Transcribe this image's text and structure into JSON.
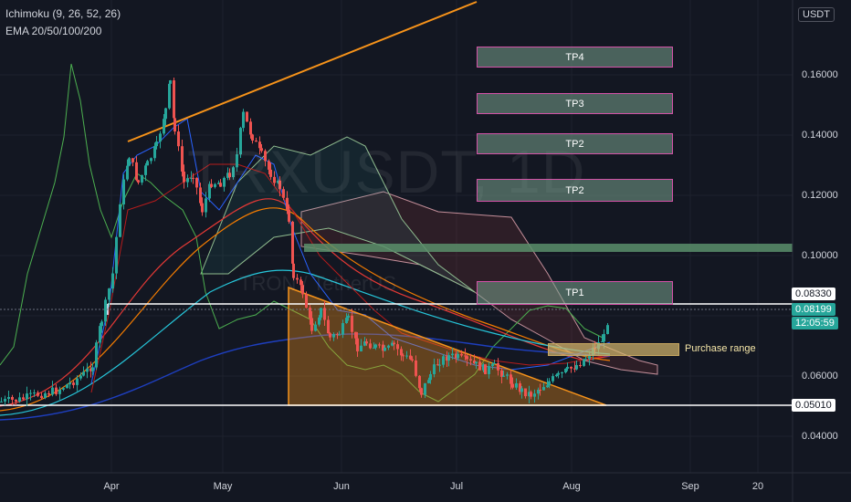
{
  "indicators": {
    "ichimoku": "Ichimoku (9, 26, 52, 26)",
    "ema": "EMA 20/50/100/200"
  },
  "watermark": {
    "symbol": "TRXUSDT, 1D",
    "pair": "TRON / TetherUS"
  },
  "price_axis": {
    "currency": "USDT",
    "ticks": [
      "0.16000",
      "0.14000",
      "0.12000",
      "0.10000",
      "0.08000",
      "0.06000",
      "0.04000"
    ],
    "level_tags": [
      {
        "value": "0.08330",
        "color": "#ffffff",
        "text": "#131722"
      },
      {
        "value": "0.08199",
        "color": "#26a69a",
        "text": "#ffffff"
      },
      {
        "value": "12:05:59",
        "color": "#26a69a",
        "text": "#ffffff"
      },
      {
        "value": "0.05010",
        "color": "#ffffff",
        "text": "#131722"
      }
    ]
  },
  "time_axis": {
    "ticks": [
      "Apr",
      "May",
      "Jun",
      "Jul",
      "Aug",
      "Sep",
      "20"
    ]
  },
  "targets": [
    {
      "label": "TP4"
    },
    {
      "label": "TP3"
    },
    {
      "label": "TP2"
    },
    {
      "label": "TP2"
    },
    {
      "label": "TP1"
    }
  ],
  "purchase_zone": {
    "label": "Purchase range"
  },
  "colors": {
    "background": "#131722",
    "up": "#26a69a",
    "down": "#ef5350",
    "trendline": "#f7931a",
    "support": "#ffffff",
    "tp_fill": "#78a08c",
    "tp_border": "#d452a8"
  }
}
